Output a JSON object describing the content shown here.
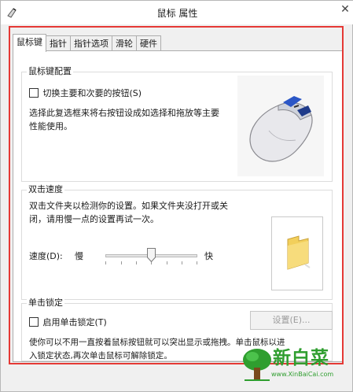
{
  "window": {
    "title": "鼠标 属性",
    "close_glyph": "✕"
  },
  "tabs": [
    {
      "label": "鼠标键",
      "active": true
    },
    {
      "label": "指针",
      "active": false
    },
    {
      "label": "指针选项",
      "active": false
    },
    {
      "label": "滑轮",
      "active": false
    },
    {
      "label": "硬件",
      "active": false
    }
  ],
  "button_config": {
    "title": "鼠标键配置",
    "switch_label": "切换主要和次要的按钮(S)",
    "switch_checked": false,
    "desc_line1": "选择此复选框来将右按钮设成如选择和拖放等主要",
    "desc_line2": "性能使用。"
  },
  "double_click": {
    "title": "双击速度",
    "desc_line1": "双击文件夹以检测你的设置。如果文件夹没打开或关",
    "desc_line2": "闭，请用慢一点的设置再试一次。",
    "speed_label": "速度(D):",
    "slow_label": "慢",
    "fast_label": "快",
    "speed_value": 0.5
  },
  "click_lock": {
    "title": "单击锁定",
    "enable_label": "启用单击锁定(T)",
    "enable_checked": false,
    "settings_button": "设置(E)...",
    "desc_line1": "使你可以不用一直按着鼠标按钮就可以突出显示或拖拽。单击鼠标以进",
    "desc_line2": "入锁定状态,再次单击鼠标可解除锁定。"
  },
  "watermark": {
    "brand": "新白菜",
    "url": "www.XinBaiCai.com"
  },
  "colors": {
    "highlight": "#e53935",
    "watermark": "#2f9e2f"
  }
}
